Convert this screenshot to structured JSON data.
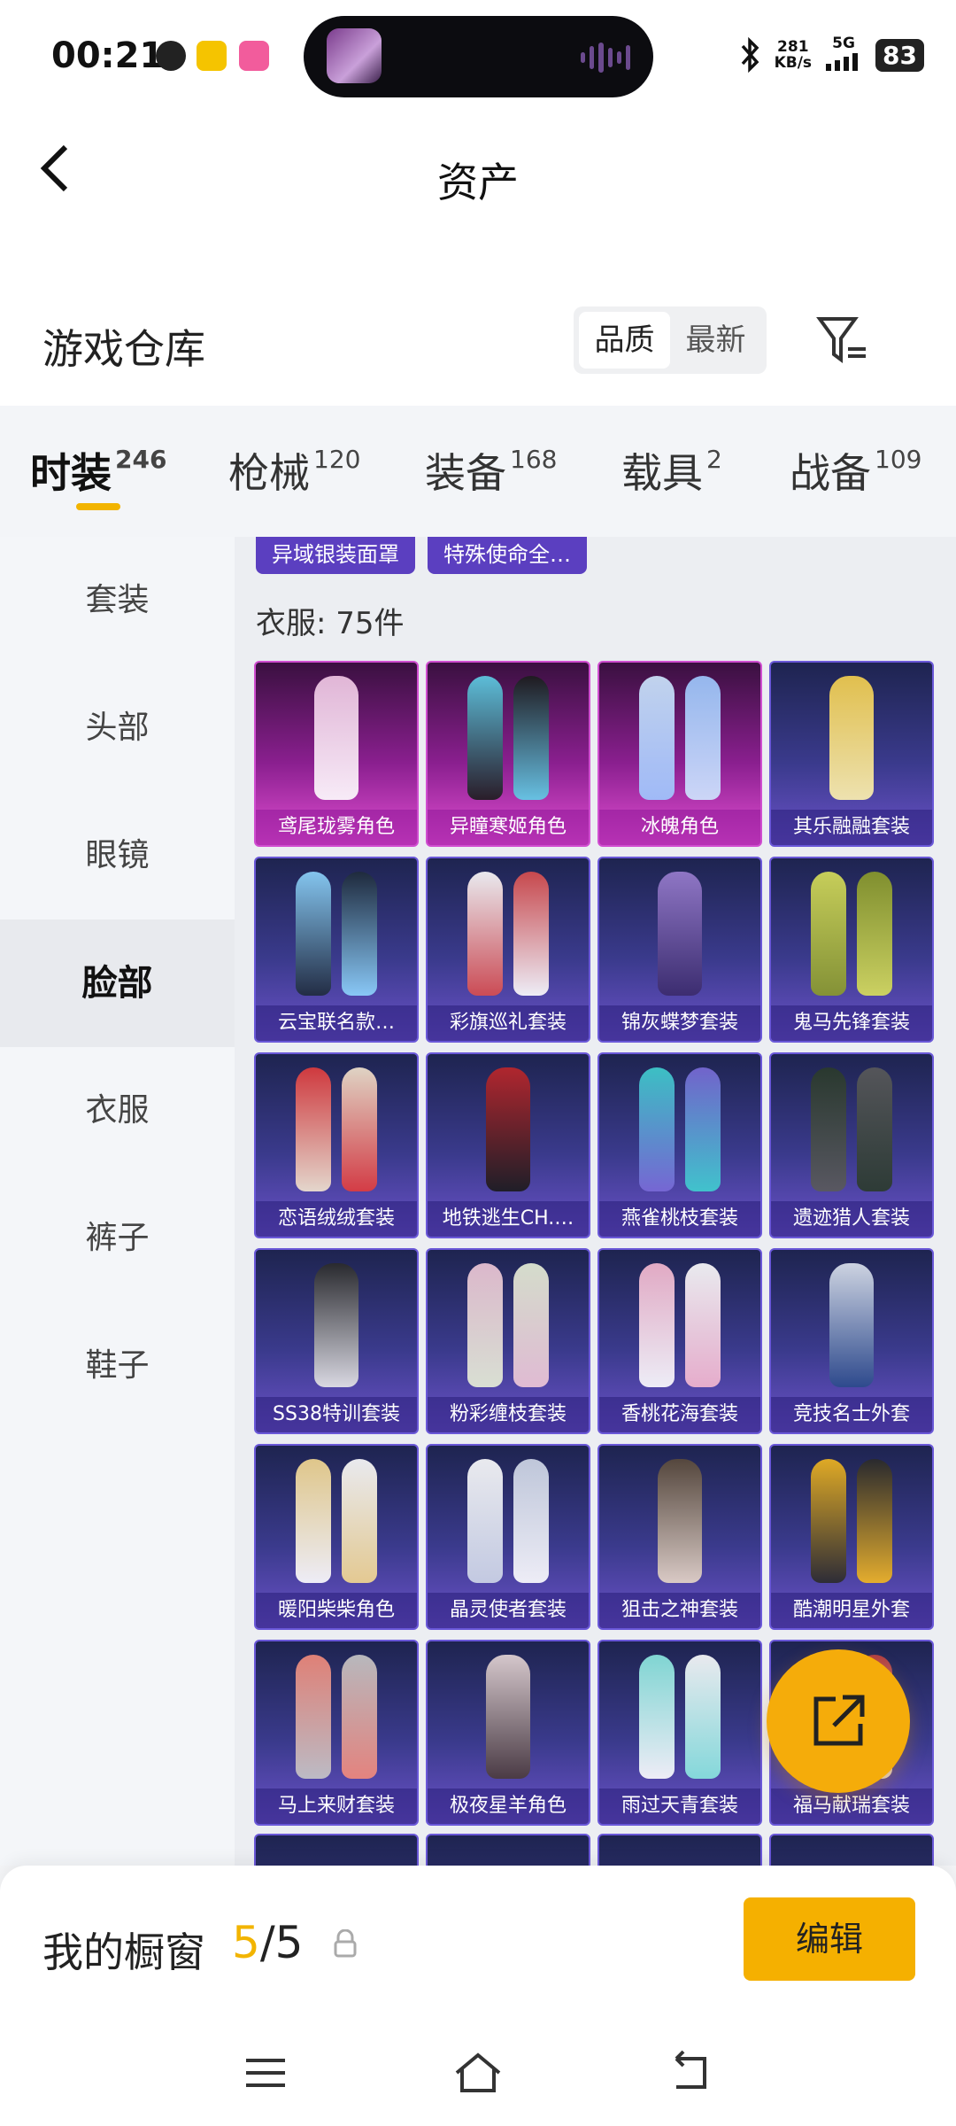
{
  "status_bar": {
    "time": "00:21",
    "net_speed": "281",
    "net_unit": "KB/s",
    "network": "5G",
    "battery": "83"
  },
  "header": {
    "back_icon": "chevron-left-icon",
    "title": "资产",
    "section_title": "游戏仓库",
    "sort_options": [
      "品质",
      "最新"
    ],
    "sort_active": "品质",
    "filter_icon": "filter-icon"
  },
  "tabs": [
    {
      "label": "时装",
      "count": "246",
      "active": true
    },
    {
      "label": "枪械",
      "count": "120",
      "active": false
    },
    {
      "label": "装备",
      "count": "168",
      "active": false
    },
    {
      "label": "载具",
      "count": "2",
      "active": false
    },
    {
      "label": "战备",
      "count": "109",
      "active": false
    }
  ],
  "sidebar": {
    "items": [
      "套装",
      "头部",
      "眼镜",
      "脸部",
      "衣服",
      "裤子",
      "鞋子"
    ],
    "active": "脸部"
  },
  "content": {
    "top_chips": [
      "异域银装面罩",
      "特殊使命全…"
    ],
    "count_label": "衣服: 75件",
    "items": [
      {
        "name": "鸢尾珑雾角色",
        "rarity": "legendary"
      },
      {
        "name": "异瞳寒姬角色",
        "rarity": "legendary"
      },
      {
        "name": "冰魄角色",
        "rarity": "legendary"
      },
      {
        "name": "其乐融融套装",
        "rarity": "epic"
      },
      {
        "name": "云宝联名款…",
        "rarity": "epic"
      },
      {
        "name": "彩旗巡礼套装",
        "rarity": "epic"
      },
      {
        "name": "锦灰蝶梦套装",
        "rarity": "epic"
      },
      {
        "name": "鬼马先锋套装",
        "rarity": "epic"
      },
      {
        "name": "恋语绒绒套装",
        "rarity": "epic"
      },
      {
        "name": "地铁逃生CH.…",
        "rarity": "epic"
      },
      {
        "name": "燕雀桃枝套装",
        "rarity": "epic"
      },
      {
        "name": "遗迹猎人套装",
        "rarity": "epic"
      },
      {
        "name": "SS38特训套装",
        "rarity": "epic"
      },
      {
        "name": "粉彩缠枝套装",
        "rarity": "epic"
      },
      {
        "name": "香桃花海套装",
        "rarity": "epic"
      },
      {
        "name": "竞技名士外套",
        "rarity": "epic"
      },
      {
        "name": "暖阳柴柴角色",
        "rarity": "epic"
      },
      {
        "name": "晶灵使者套装",
        "rarity": "epic"
      },
      {
        "name": "狙击之神套装",
        "rarity": "epic"
      },
      {
        "name": "酷潮明星外套",
        "rarity": "epic"
      },
      {
        "name": "马上来财套装",
        "rarity": "epic"
      },
      {
        "name": "极夜星羊角色",
        "rarity": "epic"
      },
      {
        "name": "雨过天青套装",
        "rarity": "epic"
      },
      {
        "name": "福马献瑞套装",
        "rarity": "epic"
      }
    ]
  },
  "fab": {
    "icon": "share-external-icon"
  },
  "bottom": {
    "showcase_label": "我的橱窗",
    "showcase_current": "5",
    "showcase_total": "/5",
    "lock_icon": "lock-icon",
    "edit_label": "编辑"
  },
  "navbar": {
    "icons": [
      "menu-icon",
      "home-icon",
      "back-icon"
    ]
  },
  "colors": {
    "accent": "#f5b000",
    "legendary_card": "#d04ed0",
    "epic_card": "#6a58d8"
  }
}
